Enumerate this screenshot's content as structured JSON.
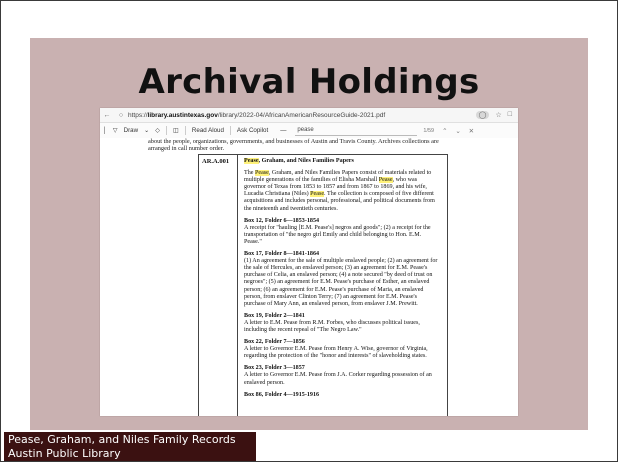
{
  "slide": {
    "title": "Archival Holdings",
    "caption_line1": "Pease, Graham, and Niles Family Records",
    "caption_line2": "Austin Public Library"
  },
  "browser": {
    "url_prefix": "https://",
    "url_domain": "library.austintexas.gov",
    "url_path": "/library/2022-04/AfricanAmericanResourceGuide-2021.pdf",
    "toolbar": {
      "draw_label": "Draw",
      "read_aloud_label": "Read Aloud",
      "ask_copilot_label": "Ask Copilot",
      "zoom_minus": "—",
      "search_value": "pease",
      "match_count": "1/59"
    }
  },
  "document": {
    "intro": "about the people, organizations, governments, and businesses of Austin and Travis County. Archives collections are arranged in call number order.",
    "record_id": "AR.A.001",
    "record_title_pre": "Pease",
    "record_title_rest": ", Graham, and Niles Families Papers",
    "desc_1": "The ",
    "desc_hl1": "Pease",
    "desc_2": ", Graham, and Niles Families Papers consist of materials related to multiple generations of the families of Elisha Marshall ",
    "desc_hl2": "Pease",
    "desc_3": ", who was governor of Texas from 1853 to 1857 and from 1867 to 1869, and his wife, Lucadia Christiana (Niles) ",
    "desc_hl3": "Pease",
    "desc_4": ". The collection is composed of five different acquisitions and includes personal, professional, and political documents from the nineteenth and twentieth centuries.",
    "boxes": [
      {
        "heading": "Box 12, Folder 6—1853-1854",
        "text": "A receipt for \"hauling [E.M. Pease's] negros and goods\"; (2) a receipt for the transportation of \"the negro girl Emily and child belonging to Hon. E.M. Pease.\""
      },
      {
        "heading": "Box 17, Folder 8—1841-1864",
        "text": "(1) An agreement for the sale of multiple enslaved people; (2) an agreement for the sale of Hercules, an enslaved person; (3) an agreement for E.M. Pease's purchase of Celia, an enslaved person; (4) a note secured \"by deed of trust on negroes\"; (5) an agreement for E.M. Pease's purchase of Esther, an enslaved person; (6) an agreement for E.M. Pease's purchase of Maria, an enslaved person, from enslaver Clinton Terry; (7) an agreement for E.M. Pease's purchase of Mary Ann, an enslaved person, from enslaver J.M. Prewitt."
      },
      {
        "heading": "Box 19, Folder 2—1841",
        "text": "A letter to E.M. Pease from R.M. Forbes, who discusses political issues, including the recent repeal of \"The Negro Law.\""
      },
      {
        "heading": "Box 22, Folder 7—1856",
        "text": "A letter to Governor E.M. Pease from Henry A. Wise, governor of Virginia, regarding the protection of the \"honor and interests\" of slaveholding states."
      },
      {
        "heading": "Box 23, Folder 3—1857",
        "text": "A letter to Governor E.M. Pease from J.A. Corker regarding possession of an enslaved person."
      },
      {
        "heading": "Box 86, Folder 4—1915-1916",
        "text": ""
      }
    ]
  },
  "colors": {
    "slide_bg": "#c9b1b1",
    "caption_bg": "#3b1111",
    "highlight": "#fff27a",
    "link": "#1a3fb8"
  }
}
